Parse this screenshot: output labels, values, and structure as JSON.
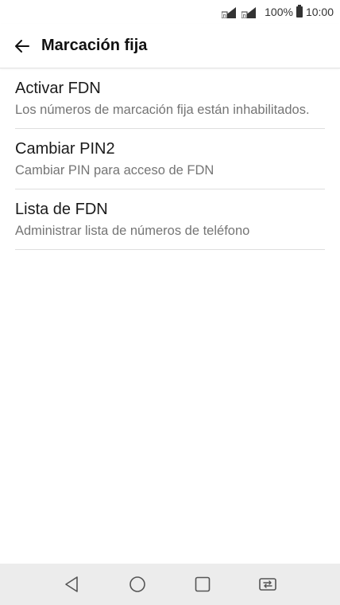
{
  "status_bar": {
    "battery_percent": "100%",
    "time": "10:00",
    "icons": [
      "sim-signal-icon",
      "sim-signal-icon",
      "battery-icon"
    ]
  },
  "header": {
    "title": "Marcación fija",
    "back_icon": "back-arrow-icon"
  },
  "items": [
    {
      "title": "Activar FDN",
      "summary": "Los números de marcación fija están inhabilitados."
    },
    {
      "title": "Cambiar PIN2",
      "summary": "Cambiar PIN para acceso de FDN"
    },
    {
      "title": "Lista de FDN",
      "summary": "Administrar lista de números de teléfono"
    }
  ],
  "nav_bar": {
    "buttons": [
      "back-triangle-icon",
      "home-circle-icon",
      "recents-square-icon",
      "dual-window-icon"
    ]
  },
  "colors": {
    "nav_bar_bg": "#ececec",
    "divider": "#dedede",
    "summary_text": "#757575"
  }
}
